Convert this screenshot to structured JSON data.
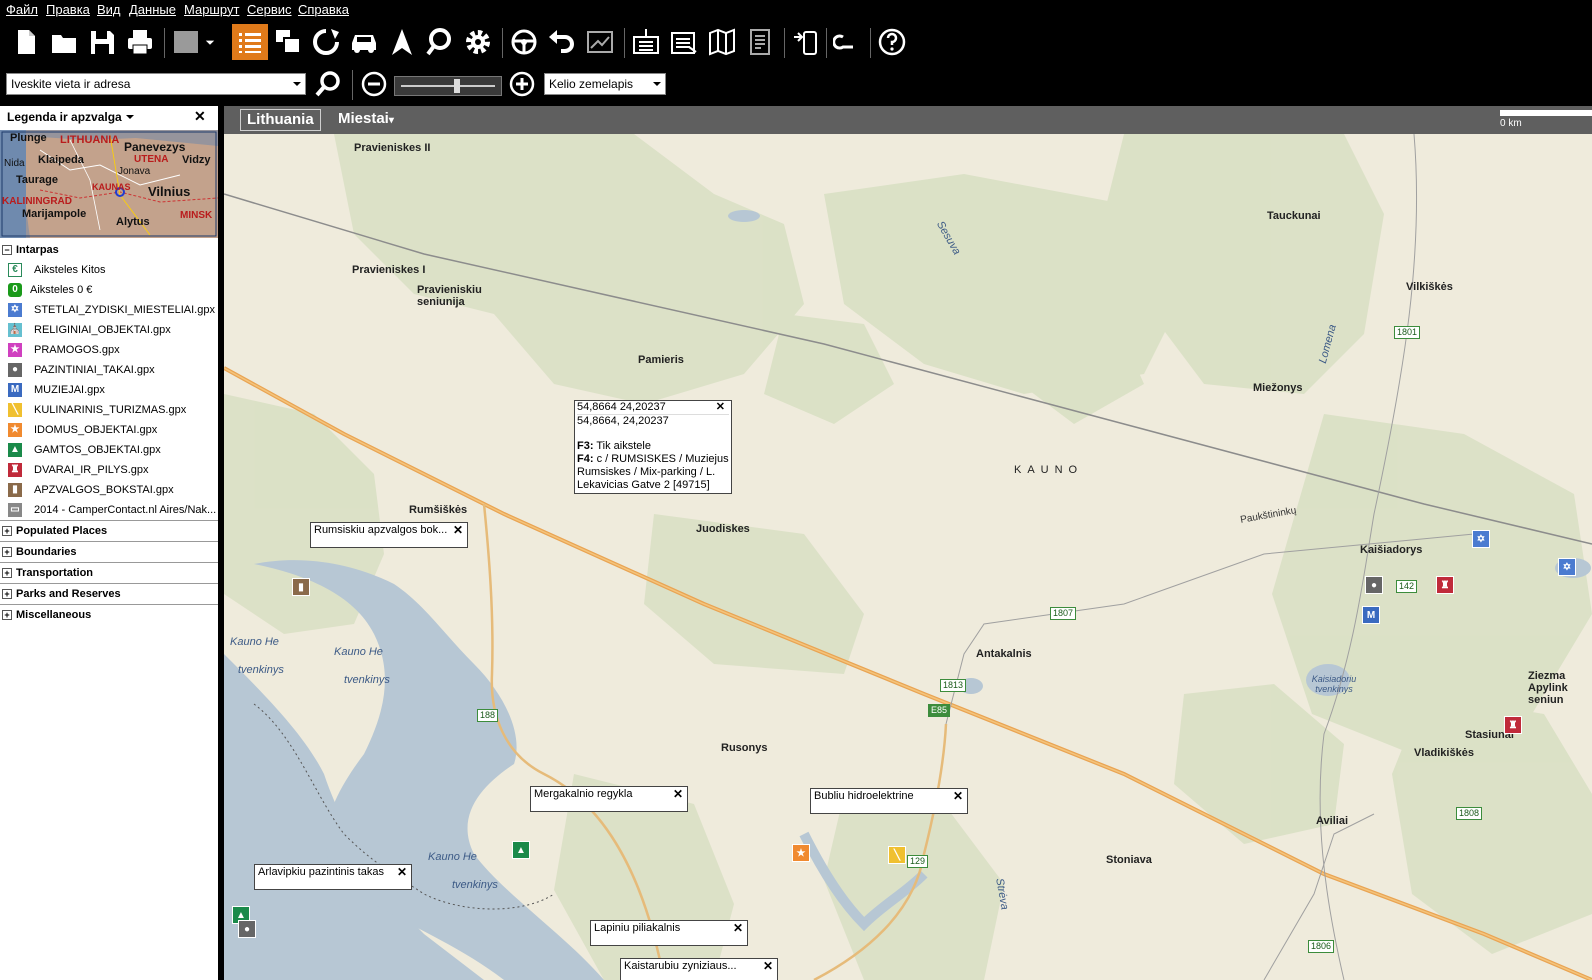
{
  "menu": [
    "Файл",
    "Правка",
    "Вид",
    "Данные",
    "Маршрут",
    "Сервис",
    "Справка"
  ],
  "toolbar": {
    "icons": [
      "new-file-icon",
      "open-folder-icon",
      "save-icon",
      "print-icon",
      "map-shade-icon",
      "chevron-down-icon",
      "list-icon",
      "copy-windows-icon",
      "route-refresh-icon",
      "car-icon",
      "navigation-arrow-icon",
      "search-map-icon",
      "gear-icon",
      "steering-wheel-icon",
      "undo-icon",
      "chart-icon",
      "import-icon",
      "export-icon",
      "map-icon",
      "document-icon",
      "device-transfer-icon",
      "link-icon",
      "help-icon"
    ]
  },
  "search": {
    "placeholder": "Iveskite vieta ir adresa"
  },
  "map_type": "Kelio zemelapis",
  "zoom": {
    "level": 0.6
  },
  "left_panel": {
    "title": "Legenda ir apzvalga",
    "overview_labels": [
      "Plunge",
      "LITHUANIA",
      "Panevezys",
      "Nida",
      "Klaipeda",
      "UTENA",
      "Vidzy",
      "Taurage",
      "Jonava",
      "Vilnius",
      "KAUNAS",
      "KALININGRAD",
      "Marijampole",
      "MINSK",
      "Alytus"
    ],
    "groups": [
      {
        "name": "Intarpas",
        "expanded": true,
        "items": [
          {
            "label": "Aiksteles Kitos",
            "icon": "euro-icon",
            "color": "#ffffff"
          },
          {
            "label": "Aiksteles 0 €",
            "icon": "zero-icon",
            "color": "#1a9a1a"
          },
          {
            "label": "STETLAI_ZYDISKI_MIESTELIAI.gpx",
            "icon": "star-of-david-icon",
            "color": "#4b7bd0"
          },
          {
            "label": "RELIGINIAI_OBJEKTAI.gpx",
            "icon": "church-icon",
            "color": "#66c0d0"
          },
          {
            "label": "PRAMOGOS.gpx",
            "icon": "star-icon",
            "color": "#d040c0"
          },
          {
            "label": "PAZINTINIAI_TAKAI.gpx",
            "icon": "footprint-icon",
            "color": "#666666"
          },
          {
            "label": "MUZIEJAI.gpx",
            "icon": "museum-icon",
            "color": "#3a6ac0"
          },
          {
            "label": "KULINARINIS_TURIZMAS.gpx",
            "icon": "cutlery-icon",
            "color": "#f0c030"
          },
          {
            "label": "IDOMUS_OBJEKTAI.gpx",
            "icon": "star-icon",
            "color": "#f08a30"
          },
          {
            "label": "GAMTOS_OBJEKTAI.gpx",
            "icon": "tree-icon",
            "color": "#1a8a4a"
          },
          {
            "label": "DVARAI_IR_PILYS.gpx",
            "icon": "castle-icon",
            "color": "#c02a3a"
          },
          {
            "label": "APZVALGOS_BOKSTAI.gpx",
            "icon": "tower-icon",
            "color": "#8a6a4a"
          },
          {
            "label": "2014 - CamperContact.nl Aires/Nak...",
            "icon": "camper-icon",
            "color": "#888888"
          }
        ]
      },
      {
        "name": "Populated Places",
        "expanded": false
      },
      {
        "name": "Boundaries",
        "expanded": false
      },
      {
        "name": "Transportation",
        "expanded": false
      },
      {
        "name": "Parks and Reserves",
        "expanded": false
      },
      {
        "name": "Miscellaneous",
        "expanded": false
      }
    ]
  },
  "map": {
    "country": "Lithuania",
    "cities_menu": "Miestai",
    "scale_label": "0 km",
    "places": [
      "Pravieniskes II",
      "Tauckunai",
      "Pravieniskes I",
      "Pravieniskiu seniunija",
      "Vilkiškės",
      "Pamieris",
      "Miežonys",
      "KAUNO",
      "Rumšiškės",
      "Juodiskes",
      "Kaišiadorys",
      "Antakalnis",
      "Rusonys",
      "Stasiunai",
      "Vladikiškės",
      "Aviliai",
      "Stoniava",
      "Ziezma Apylink seniun"
    ],
    "waters": [
      "Sesuva",
      "Lomena",
      "Kauno He",
      "tvenkinys",
      "Kauno He",
      "tvenkinys",
      "Kaisiadoriu tvenkinys",
      "Kauno He",
      "tvenkinys",
      "Strėva"
    ],
    "road_labels": [
      "Paukštininkų"
    ],
    "roads": [
      "1801",
      "1807",
      "142",
      "1813",
      "E85",
      "188",
      "129",
      "1808",
      "1806"
    ],
    "hint": {
      "title": "54,8664 24,20237",
      "coords": "54,8664, 24,20237",
      "f3_key": "F3:",
      "f3_text": "Tik aikstele",
      "f4_key": "F4:",
      "f4_text": "c / RUMSISKES / Muziejus",
      "f4_line2": "Rumsiskes / Mix-parking / L.",
      "f4_line3": "Lekavicias Gatve 2 [49715]"
    },
    "callouts": [
      "Rumsiskiu apzvalgos bok...",
      "Mergakalnio regykla",
      "Bubliu hidroelektrine",
      "Arlavipkiu pazintinis takas",
      "Lapiniu piliakalnis",
      "Kaistarubiu zyniziaus..."
    ],
    "close_symbol": "✕"
  }
}
